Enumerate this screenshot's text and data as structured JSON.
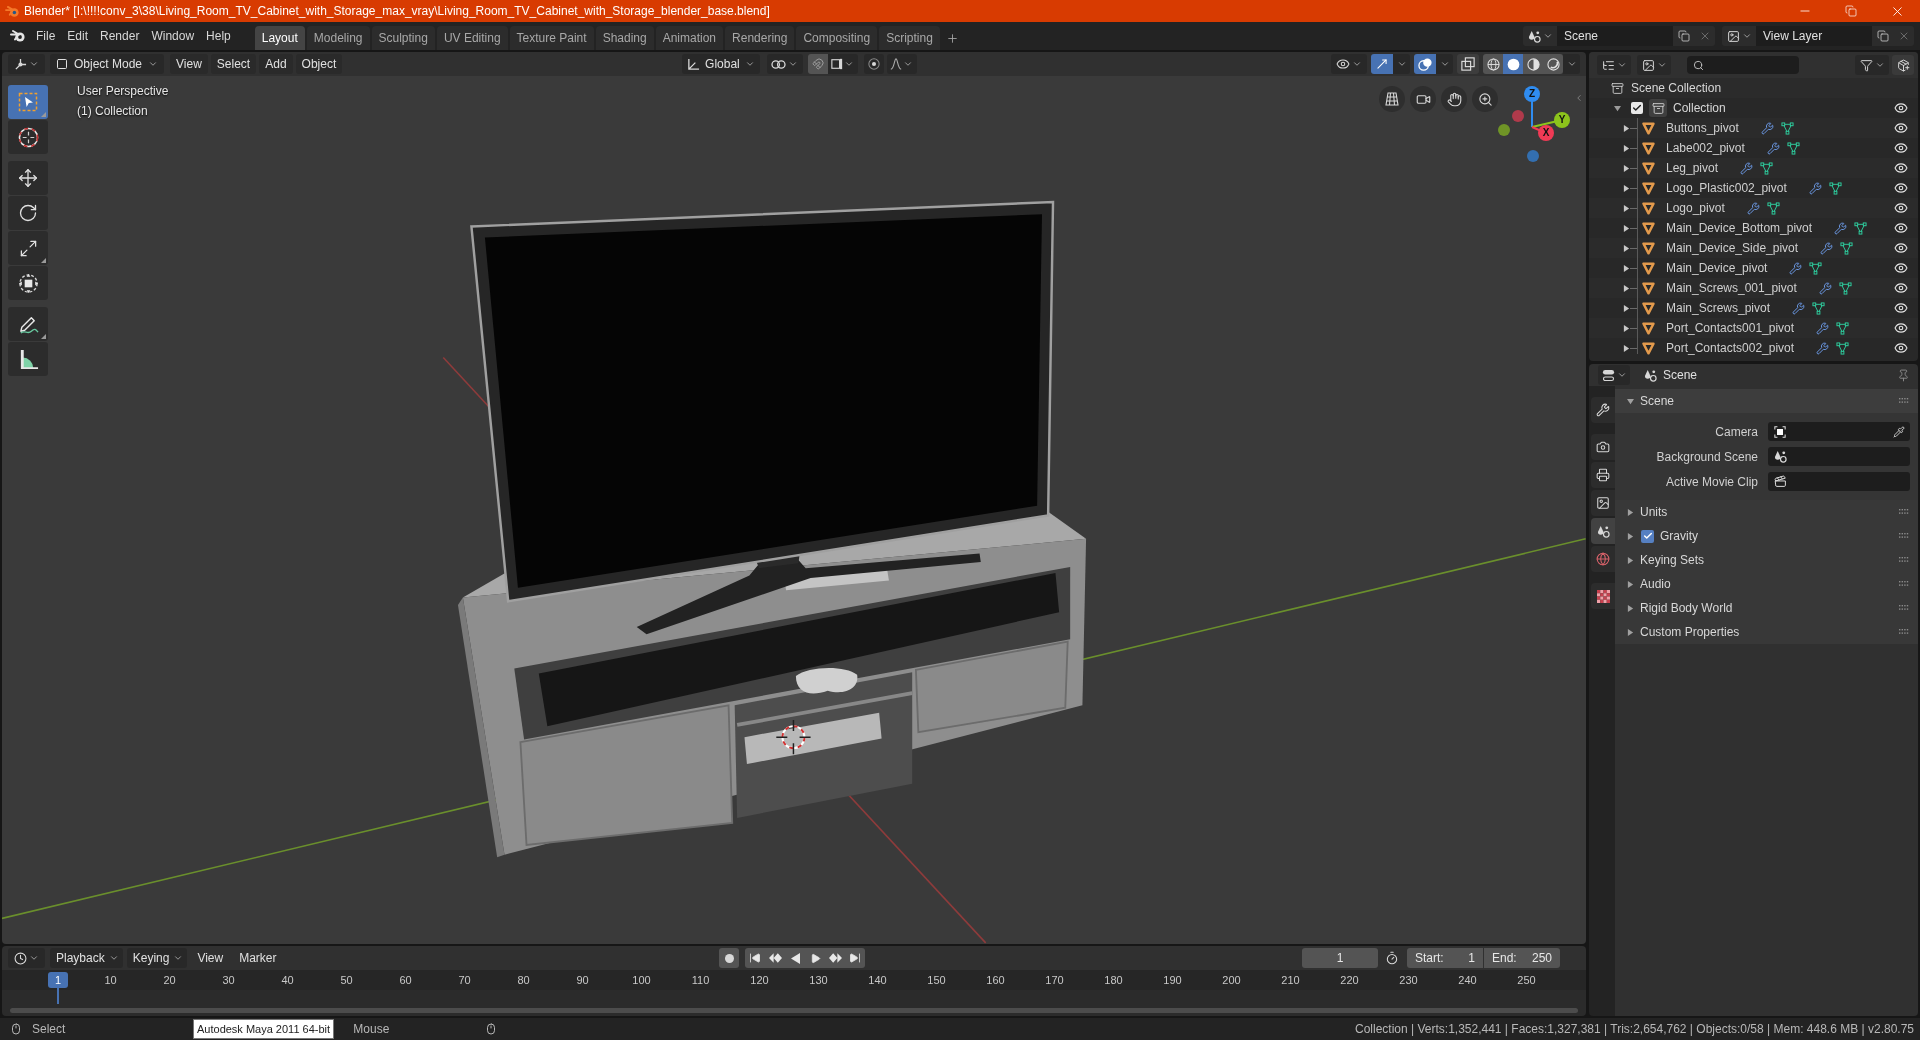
{
  "window": {
    "title": "Blender* [I:\\!!!!conv_3\\38\\Living_Room_TV_Cabinet_with_Storage_max_vray\\Living_Room_TV_Cabinet_with_Storage_blender_base.blend]"
  },
  "menu": [
    "File",
    "Edit",
    "Render",
    "Window",
    "Help"
  ],
  "workspaces": [
    {
      "label": "Layout",
      "selected": true
    },
    {
      "label": "Modeling",
      "selected": false
    },
    {
      "label": "Sculpting",
      "selected": false
    },
    {
      "label": "UV Editing",
      "selected": false
    },
    {
      "label": "Texture Paint",
      "selected": false
    },
    {
      "label": "Shading",
      "selected": false
    },
    {
      "label": "Animation",
      "selected": false
    },
    {
      "label": "Rendering",
      "selected": false
    },
    {
      "label": "Compositing",
      "selected": false
    },
    {
      "label": "Scripting",
      "selected": false
    }
  ],
  "scene_selector": {
    "value": "Scene"
  },
  "view_layer_selector": {
    "value": "View Layer"
  },
  "viewport": {
    "mode": "Object Mode",
    "menus": [
      "View",
      "Select",
      "Add",
      "Object"
    ],
    "orientation": "Global",
    "toggles": [
      {
        "kind": "gizmos",
        "on": true
      },
      {
        "kind": "overlays",
        "on": true
      },
      {
        "kind": "xray",
        "on": false
      }
    ],
    "shading": [
      {
        "kind": "wireframe",
        "selected": false
      },
      {
        "kind": "solid",
        "selected": true
      },
      {
        "kind": "material",
        "selected": false
      },
      {
        "kind": "rendered",
        "selected": false
      }
    ],
    "info": [
      "User Perspective",
      "(1) Collection"
    ],
    "tools": [
      [
        {
          "kind": "select",
          "selected": true,
          "submenu": true
        },
        {
          "kind": "cursor",
          "selected": false,
          "submenu": false
        }
      ],
      [
        {
          "kind": "move",
          "selected": false,
          "submenu": false
        },
        {
          "kind": "rotate",
          "selected": false,
          "submenu": false
        },
        {
          "kind": "scale",
          "selected": false,
          "submenu": true
        },
        {
          "kind": "transform",
          "selected": false,
          "submenu": false
        }
      ],
      [
        {
          "kind": "annotate",
          "selected": false,
          "submenu": true
        },
        {
          "kind": "measure",
          "selected": false,
          "submenu": false
        }
      ]
    ],
    "gizmo": [
      {
        "kind": "z",
        "label": "Z",
        "color": "#2f8cf0"
      },
      {
        "kind": "y",
        "label": "Y",
        "color": "#8cc41c"
      },
      {
        "kind": "x",
        "label": "X",
        "color": "#f03a55"
      }
    ]
  },
  "outliner": {
    "root": "Scene Collection",
    "items": [
      {
        "label": "Collection",
        "checked": true,
        "expanded": true,
        "children": [
          {
            "label": "Buttons_pivot",
            "expanded": false
          },
          {
            "label": "Labe002_pivot",
            "expanded": false
          },
          {
            "label": "Leg_pivot",
            "expanded": false
          },
          {
            "label": "Logo_Plastic002_pivot",
            "expanded": false
          },
          {
            "label": "Logo_pivot",
            "expanded": false
          },
          {
            "label": "Main_Device_Bottom_pivot",
            "expanded": false
          },
          {
            "label": "Main_Device_Side_pivot",
            "expanded": false
          },
          {
            "label": "Main_Device_pivot",
            "expanded": false
          },
          {
            "label": "Main_Screws_001_pivot",
            "expanded": false
          },
          {
            "label": "Main_Screws_pivot",
            "expanded": false
          },
          {
            "label": "Port_Contacts001_pivot",
            "expanded": false
          },
          {
            "label": "Port_Contacts002_pivot",
            "expanded": false
          }
        ]
      }
    ]
  },
  "properties": {
    "context": "Scene",
    "tab_groups": [
      [
        {
          "kind": "tool",
          "selected": false
        }
      ],
      [
        {
          "kind": "render",
          "selected": false
        },
        {
          "kind": "output",
          "selected": false
        },
        {
          "kind": "view_layer",
          "selected": false
        },
        {
          "kind": "scene",
          "selected": true
        },
        {
          "kind": "world",
          "selected": false
        }
      ],
      [
        {
          "kind": "texture",
          "selected": false
        }
      ]
    ],
    "panels": [
      {
        "title": "Scene",
        "expanded": true,
        "fields": [
          {
            "label": "Camera",
            "kind": "camera"
          },
          {
            "label": "Background Scene",
            "kind": "scene"
          },
          {
            "label": "Active Movie Clip",
            "kind": "clip"
          }
        ]
      },
      {
        "title": "Units",
        "expanded": false
      },
      {
        "title": "Gravity",
        "expanded": false,
        "checked": true
      },
      {
        "title": "Keying Sets",
        "expanded": false
      },
      {
        "title": "Audio",
        "expanded": false
      },
      {
        "title": "Rigid Body World",
        "expanded": false
      },
      {
        "title": "Custom Properties",
        "expanded": false
      }
    ]
  },
  "timeline": {
    "menus": [
      {
        "label": "Playback",
        "kind": "dropdown"
      },
      {
        "label": "Keying",
        "kind": "dropdown"
      },
      {
        "label": "View",
        "kind": "menu"
      },
      {
        "label": "Marker",
        "kind": "menu"
      }
    ],
    "current_frame": "1",
    "start": {
      "label": "Start:",
      "value": "1"
    },
    "end": {
      "label": "End:",
      "value": "250"
    },
    "playhead": "1",
    "ticks": [
      "10",
      "20",
      "30",
      "40",
      "50",
      "60",
      "70",
      "80",
      "90",
      "100",
      "110",
      "120",
      "130",
      "140",
      "150",
      "160",
      "170",
      "180",
      "190",
      "200",
      "210",
      "220",
      "230",
      "240",
      "250"
    ]
  },
  "status_bar": {
    "hint": "Select",
    "tooltip": "Autodesk Maya 2011 64-bit",
    "hint_2": "Mouse",
    "stats": "Collection | Verts:1,352,441 | Faces:1,327,381 | Tris:2,654,762 | Objects:0/58 | Mem: 448.6 MB | v2.80.75"
  }
}
